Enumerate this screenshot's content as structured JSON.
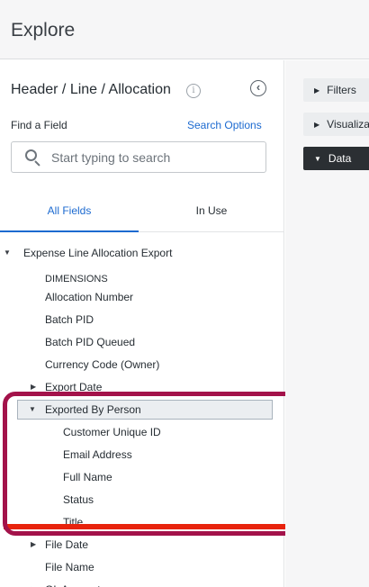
{
  "app": {
    "title": "Explore"
  },
  "panel": {
    "title": "Header / Line / Allocation",
    "info_icon": "info-icon",
    "collapse_icon": "chevron-left-circle-icon",
    "find_label": "Find a Field",
    "search_options": "Search Options",
    "search_placeholder": "Start typing to search",
    "search_value": ""
  },
  "tabs": [
    {
      "label": "All Fields",
      "active": true
    },
    {
      "label": "In Use",
      "active": false
    }
  ],
  "tree": {
    "view": "Expense Line Allocation Export",
    "section": "DIMENSIONS",
    "top_fields": [
      "Allocation Number",
      "Batch PID",
      "Batch PID Queued",
      "Currency Code (Owner)"
    ],
    "group_export_date": "Export Date",
    "group_exported_by": "Exported By Person",
    "exported_by_fields": [
      "Customer Unique ID",
      "Email Address",
      "Full Name",
      "Status",
      "Title"
    ],
    "group_file_date": "File Date",
    "file_name": "File Name",
    "gl_account": "GL Account"
  },
  "right_panel": {
    "filters": "Filters",
    "visualization": "Visualization",
    "data": "Data"
  },
  "colors": {
    "accent": "#1c6ad0",
    "annotation": "#a3124a",
    "dark_button": "#2b2f33"
  }
}
